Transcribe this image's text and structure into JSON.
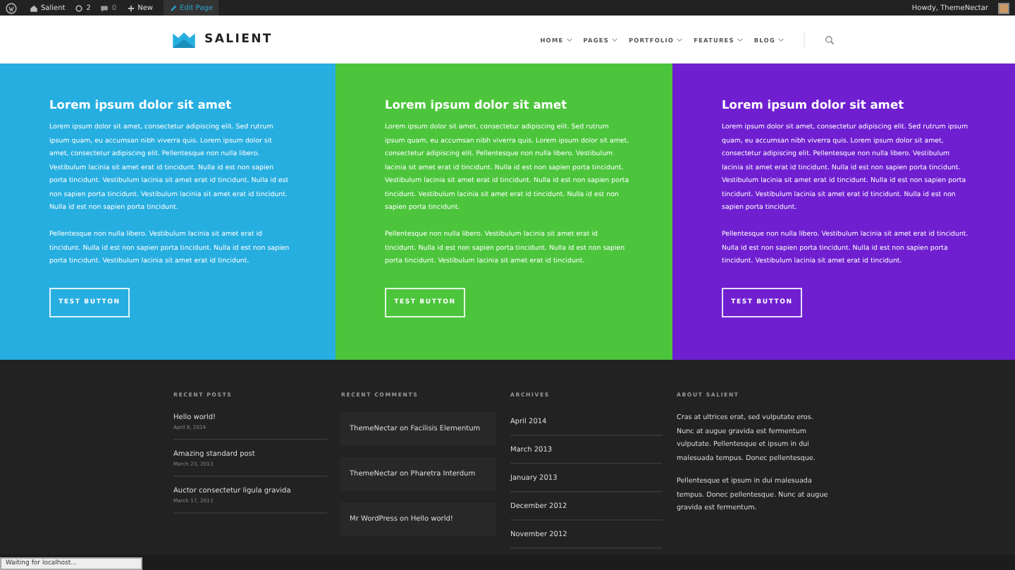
{
  "admin_bar": {
    "site": "Salient",
    "updates": "2",
    "comments": "0",
    "new": "New",
    "edit": "Edit Page",
    "greeting": "Howdy, ThemeNectar"
  },
  "header": {
    "logo": "SALIENT",
    "nav": [
      {
        "label": "HOME"
      },
      {
        "label": "PAGES"
      },
      {
        "label": "PORTFOLIO"
      },
      {
        "label": "FEATURES"
      },
      {
        "label": "BLOG"
      }
    ]
  },
  "columns": [
    {
      "color": "#27aee0",
      "title": "Lorem ipsum dolor sit amet",
      "paragraphs": [
        "Lorem ipsum dolor sit amet, consectetur adipiscing elit. Sed rutrum ipsum quam, eu accumsan nibh viverra quis. Lorem ipsum dolor sit amet, consectetur adipiscing elit. Pellentesque non nulla libero. Vestibulum lacinia sit amet erat id tincidunt. Nulla id est non sapien porta tincidunt. Vestibulum lacinia sit amet erat id tincidunt. Nulla id est non sapien porta tincidunt. Vestibulum lacinia sit amet erat id tincidunt. Nulla id est non sapien porta tincidunt.",
        "Pellentesque non nulla libero. Vestibulum lacinia sit amet erat id tincidunt. Nulla id est non sapien porta tincidunt. Nulla id est non sapien porta tincidunt. Vestibulum lacinia sit amet erat id tincidunt."
      ],
      "button": "TEST BUTTON"
    },
    {
      "color": "#4cc53c",
      "title": "Lorem ipsum dolor sit amet",
      "paragraphs": [
        "Lorem ipsum dolor sit amet, consectetur adipiscing elit. Sed rutrum ipsum quam, eu accumsan nibh viverra quis. Lorem ipsum dolor sit amet, consectetur adipiscing elit. Pellentesque non nulla libero. Vestibulum lacinia sit amet erat id tincidunt. Nulla id est non sapien porta tincidunt. Vestibulum lacinia sit amet erat id tincidunt. Nulla id est non sapien porta tincidunt. Vestibulum lacinia sit amet erat id tincidunt. Nulla id est non sapien porta tincidunt.",
        "Pellentesque non nulla libero. Vestibulum lacinia sit amet erat id tincidunt. Nulla id est non sapien porta tincidunt. Nulla id est non sapien porta tincidunt. Vestibulum lacinia sit amet erat id tincidunt."
      ],
      "button": "TEST BUTTON"
    },
    {
      "color": "#6f1fd0",
      "title": "Lorem ipsum dolor sit amet",
      "paragraphs": [
        "Lorem ipsum dolor sit amet, consectetur adipiscing elit. Sed rutrum ipsum quam, eu accumsan nibh viverra quis. Lorem ipsum dolor sit amet, consectetur adipiscing elit. Pellentesque non nulla libero. Vestibulum lacinia sit amet erat id tincidunt. Nulla id est non sapien porta tincidunt. Vestibulum lacinia sit amet erat id tincidunt. Nulla id est non sapien porta tincidunt. Vestibulum lacinia sit amet erat id tincidunt. Nulla id est non sapien porta tincidunt.",
        "Pellentesque non nulla libero. Vestibulum lacinia sit amet erat id tincidunt. Nulla id est non sapien porta tincidunt. Nulla id est non sapien porta tincidunt. Vestibulum lacinia sit amet erat id tincidunt."
      ],
      "button": "TEST BUTTON"
    }
  ],
  "footer": {
    "recent_posts": {
      "title": "RECENT POSTS",
      "items": [
        {
          "title": "Hello world!",
          "date": "April 8, 2014"
        },
        {
          "title": "Amazing standard post",
          "date": "March 23, 2013"
        },
        {
          "title": "Auctor consectetur ligula gravida",
          "date": "March 17, 2013"
        }
      ]
    },
    "recent_comments": {
      "title": "RECENT COMMENTS",
      "items": [
        "ThemeNectar on Facilisis Elementum",
        "ThemeNectar on Pharetra Interdum",
        "Mr WordPress on Hello world!"
      ]
    },
    "archives": {
      "title": "ARCHIVES",
      "items": [
        "April 2014",
        "March 2013",
        "January 2013",
        "December 2012",
        "November 2012"
      ]
    },
    "about": {
      "title": "ABOUT SALIENT",
      "paragraphs": [
        "Cras at ultrices erat, sed vulputate eros. Nunc at augue gravida est fermentum vulputate. Pellentesque et ipsum in dui malesuada tempus. Donec pellentesque.",
        "Pellentesque et ipsum in dui malesuada tempus. Donec pellentesque. Nunc at augue gravida est fermentum."
      ]
    }
  },
  "status_bar": "Waiting for localhost..."
}
